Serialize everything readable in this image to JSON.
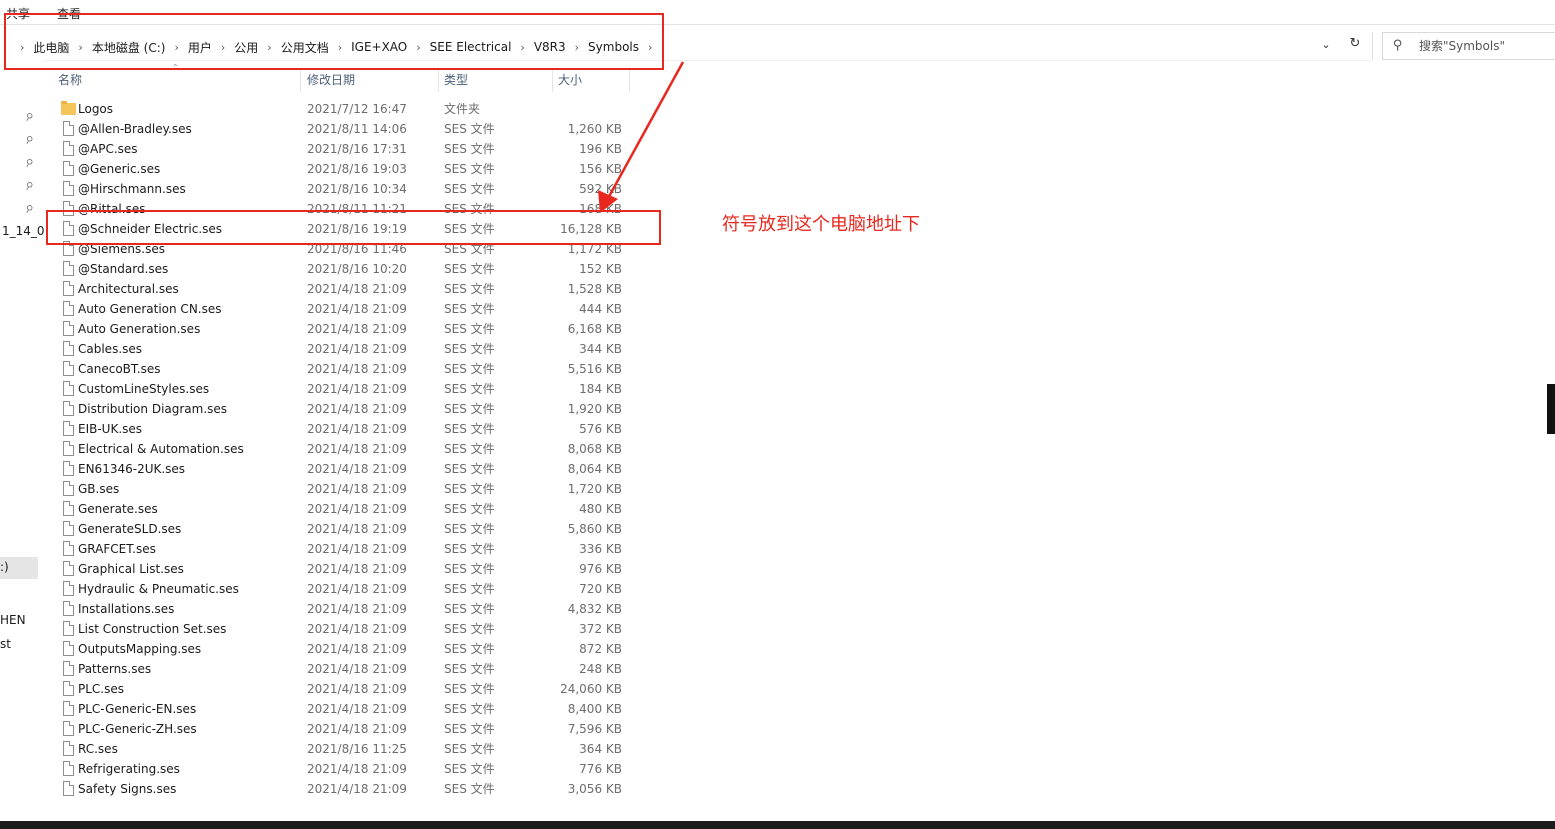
{
  "ribbon": {
    "tab_share": "共享",
    "tab_view": "查看"
  },
  "address": {
    "crumbs": [
      "此电脑",
      "本地磁盘 (C:)",
      "用户",
      "公用",
      "公用文档",
      "IGE+XAO",
      "SEE Electrical",
      "V8R3",
      "Symbols"
    ]
  },
  "search": {
    "placeholder": "搜索\"Symbols\""
  },
  "nav": {
    "label_a": "1_14_0",
    "label_b": ":)",
    "label_c": "HEN",
    "label_d": "st"
  },
  "columns": {
    "name": "名称",
    "date": "修改日期",
    "type": "类型",
    "size": "大小"
  },
  "files": [
    {
      "name": "Logos",
      "date": "2021/7/12 16:47",
      "type": "文件夹",
      "size": "",
      "kind": "folder"
    },
    {
      "name": "@Allen-Bradley.ses",
      "date": "2021/8/11 14:06",
      "type": "SES 文件",
      "size": "1,260 KB",
      "kind": "file"
    },
    {
      "name": "@APC.ses",
      "date": "2021/8/16 17:31",
      "type": "SES 文件",
      "size": "196 KB",
      "kind": "file"
    },
    {
      "name": "@Generic.ses",
      "date": "2021/8/16 19:03",
      "type": "SES 文件",
      "size": "156 KB",
      "kind": "file"
    },
    {
      "name": "@Hirschmann.ses",
      "date": "2021/8/16 10:34",
      "type": "SES 文件",
      "size": "592 KB",
      "kind": "file"
    },
    {
      "name": "@Rittal.ses",
      "date": "2021/8/11 11:21",
      "type": "SES 文件",
      "size": "168 KB",
      "kind": "file"
    },
    {
      "name": "@Schneider Electric.ses",
      "date": "2021/8/16 19:19",
      "type": "SES 文件",
      "size": "16,128 KB",
      "kind": "file"
    },
    {
      "name": "@Siemens.ses",
      "date": "2021/8/16 11:46",
      "type": "SES 文件",
      "size": "1,172 KB",
      "kind": "file"
    },
    {
      "name": "@Standard.ses",
      "date": "2021/8/16 10:20",
      "type": "SES 文件",
      "size": "152 KB",
      "kind": "file"
    },
    {
      "name": "Architectural.ses",
      "date": "2021/4/18 21:09",
      "type": "SES 文件",
      "size": "1,528 KB",
      "kind": "file"
    },
    {
      "name": "Auto Generation CN.ses",
      "date": "2021/4/18 21:09",
      "type": "SES 文件",
      "size": "444 KB",
      "kind": "file"
    },
    {
      "name": "Auto Generation.ses",
      "date": "2021/4/18 21:09",
      "type": "SES 文件",
      "size": "6,168 KB",
      "kind": "file"
    },
    {
      "name": "Cables.ses",
      "date": "2021/4/18 21:09",
      "type": "SES 文件",
      "size": "344 KB",
      "kind": "file"
    },
    {
      "name": "CanecoBT.ses",
      "date": "2021/4/18 21:09",
      "type": "SES 文件",
      "size": "5,516 KB",
      "kind": "file"
    },
    {
      "name": "CustomLineStyles.ses",
      "date": "2021/4/18 21:09",
      "type": "SES 文件",
      "size": "184 KB",
      "kind": "file"
    },
    {
      "name": "Distribution Diagram.ses",
      "date": "2021/4/18 21:09",
      "type": "SES 文件",
      "size": "1,920 KB",
      "kind": "file"
    },
    {
      "name": "EIB-UK.ses",
      "date": "2021/4/18 21:09",
      "type": "SES 文件",
      "size": "576 KB",
      "kind": "file"
    },
    {
      "name": "Electrical & Automation.ses",
      "date": "2021/4/18 21:09",
      "type": "SES 文件",
      "size": "8,068 KB",
      "kind": "file"
    },
    {
      "name": "EN61346-2UK.ses",
      "date": "2021/4/18 21:09",
      "type": "SES 文件",
      "size": "8,064 KB",
      "kind": "file"
    },
    {
      "name": "GB.ses",
      "date": "2021/4/18 21:09",
      "type": "SES 文件",
      "size": "1,720 KB",
      "kind": "file"
    },
    {
      "name": "Generate.ses",
      "date": "2021/4/18 21:09",
      "type": "SES 文件",
      "size": "480 KB",
      "kind": "file"
    },
    {
      "name": "GenerateSLD.ses",
      "date": "2021/4/18 21:09",
      "type": "SES 文件",
      "size": "5,860 KB",
      "kind": "file"
    },
    {
      "name": "GRAFCET.ses",
      "date": "2021/4/18 21:09",
      "type": "SES 文件",
      "size": "336 KB",
      "kind": "file"
    },
    {
      "name": "Graphical List.ses",
      "date": "2021/4/18 21:09",
      "type": "SES 文件",
      "size": "976 KB",
      "kind": "file"
    },
    {
      "name": "Hydraulic & Pneumatic.ses",
      "date": "2021/4/18 21:09",
      "type": "SES 文件",
      "size": "720 KB",
      "kind": "file"
    },
    {
      "name": "Installations.ses",
      "date": "2021/4/18 21:09",
      "type": "SES 文件",
      "size": "4,832 KB",
      "kind": "file"
    },
    {
      "name": "List Construction Set.ses",
      "date": "2021/4/18 21:09",
      "type": "SES 文件",
      "size": "372 KB",
      "kind": "file"
    },
    {
      "name": "OutputsMapping.ses",
      "date": "2021/4/18 21:09",
      "type": "SES 文件",
      "size": "872 KB",
      "kind": "file"
    },
    {
      "name": "Patterns.ses",
      "date": "2021/4/18 21:09",
      "type": "SES 文件",
      "size": "248 KB",
      "kind": "file"
    },
    {
      "name": "PLC.ses",
      "date": "2021/4/18 21:09",
      "type": "SES 文件",
      "size": "24,060 KB",
      "kind": "file"
    },
    {
      "name": "PLC-Generic-EN.ses",
      "date": "2021/4/18 21:09",
      "type": "SES 文件",
      "size": "8,400 KB",
      "kind": "file"
    },
    {
      "name": "PLC-Generic-ZH.ses",
      "date": "2021/4/18 21:09",
      "type": "SES 文件",
      "size": "7,596 KB",
      "kind": "file"
    },
    {
      "name": "RC.ses",
      "date": "2021/8/16 11:25",
      "type": "SES 文件",
      "size": "364 KB",
      "kind": "file"
    },
    {
      "name": "Refrigerating.ses",
      "date": "2021/4/18 21:09",
      "type": "SES 文件",
      "size": "776 KB",
      "kind": "file"
    },
    {
      "name": "Safety Signs.ses",
      "date": "2021/4/18 21:09",
      "type": "SES 文件",
      "size": "3,056 KB",
      "kind": "file"
    }
  ],
  "annotation": {
    "text": "符号放到这个电脑地址下",
    "color": "#e8281f"
  },
  "icons": {
    "folder": "folder-icon",
    "file": "file-icon",
    "pin": "pin-icon",
    "search": "search-icon",
    "refresh": "refresh-icon",
    "dropdown": "chevron-down-icon"
  }
}
